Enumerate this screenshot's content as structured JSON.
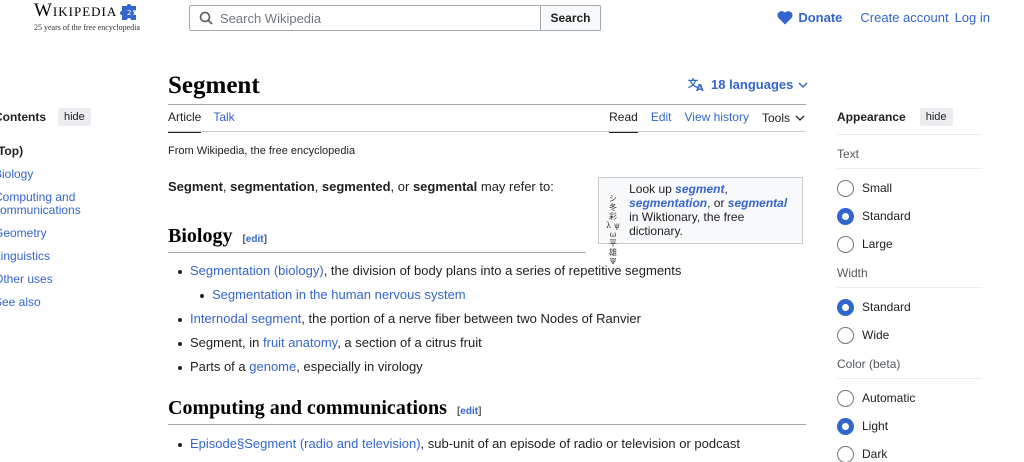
{
  "header": {
    "logo_word": "Wikipedia",
    "logo_tagline": "25 years of the free encyclopedia",
    "search_placeholder": "Search Wikipedia",
    "search_button": "Search",
    "donate": "Donate",
    "create_account": "Create account",
    "log_in": "Log in"
  },
  "toc": {
    "title": "Contents",
    "hide": "hide",
    "items": [
      "(Top)",
      "Biology",
      "Computing and communications",
      "Geometry",
      "Linguistics",
      "Other uses",
      "See also"
    ]
  },
  "article": {
    "title": "Segment",
    "languages": "18 languages",
    "tabs_left": [
      "Article",
      "Talk"
    ],
    "tabs_right": [
      "Read",
      "Edit",
      "View history",
      "Tools"
    ],
    "from": "From Wikipedia, the free encyclopedia",
    "intro": {
      "term1": "Segment",
      "sep1": ", ",
      "term2": "segmentation",
      "sep2": ", ",
      "term3": "segmented",
      "sep3": ", or ",
      "term4": "segmental",
      "rest": " may refer to:"
    },
    "wiktionary": {
      "pre": "Look up ",
      "w1": "segment",
      "c1": ",",
      "w2": "segmentation",
      "c2": ", or",
      "w3": "segmental",
      "post": " in Wiktionary, the free dictionary."
    },
    "edit_label": "edit",
    "biology": {
      "heading": "Biology",
      "items": [
        {
          "link": "Segmentation (biology)",
          "text": ", the division of body plans into a series of repetitive segments"
        },
        {
          "link": "Segmentation in the human nervous system",
          "text": ""
        },
        {
          "link": "Internodal segment",
          "text": ", the portion of a nerve fiber between two Nodes of Ranvier"
        },
        {
          "pre": "Segment, in ",
          "link": "fruit anatomy",
          "text": ", a section of a citrus fruit"
        },
        {
          "pre": "Parts of a ",
          "link": "genome",
          "text": ", especially in virology"
        }
      ]
    },
    "computing": {
      "heading": "Computing and communications",
      "items": [
        {
          "link": "Episode§Segment (radio and television)",
          "text": ", sub-unit of an episode of radio or television or podcast"
        }
      ]
    }
  },
  "appearance": {
    "title": "Appearance",
    "hide": "hide",
    "text_label": "Text",
    "text_options": [
      "Small",
      "Standard",
      "Large"
    ],
    "text_selected": "Standard",
    "width_label": "Width",
    "width_options": [
      "Standard",
      "Wide"
    ],
    "width_selected": "Standard",
    "color_label": "Color (beta)",
    "color_options": [
      "Automatic",
      "Light",
      "Dark"
    ],
    "color_selected": "Light"
  }
}
